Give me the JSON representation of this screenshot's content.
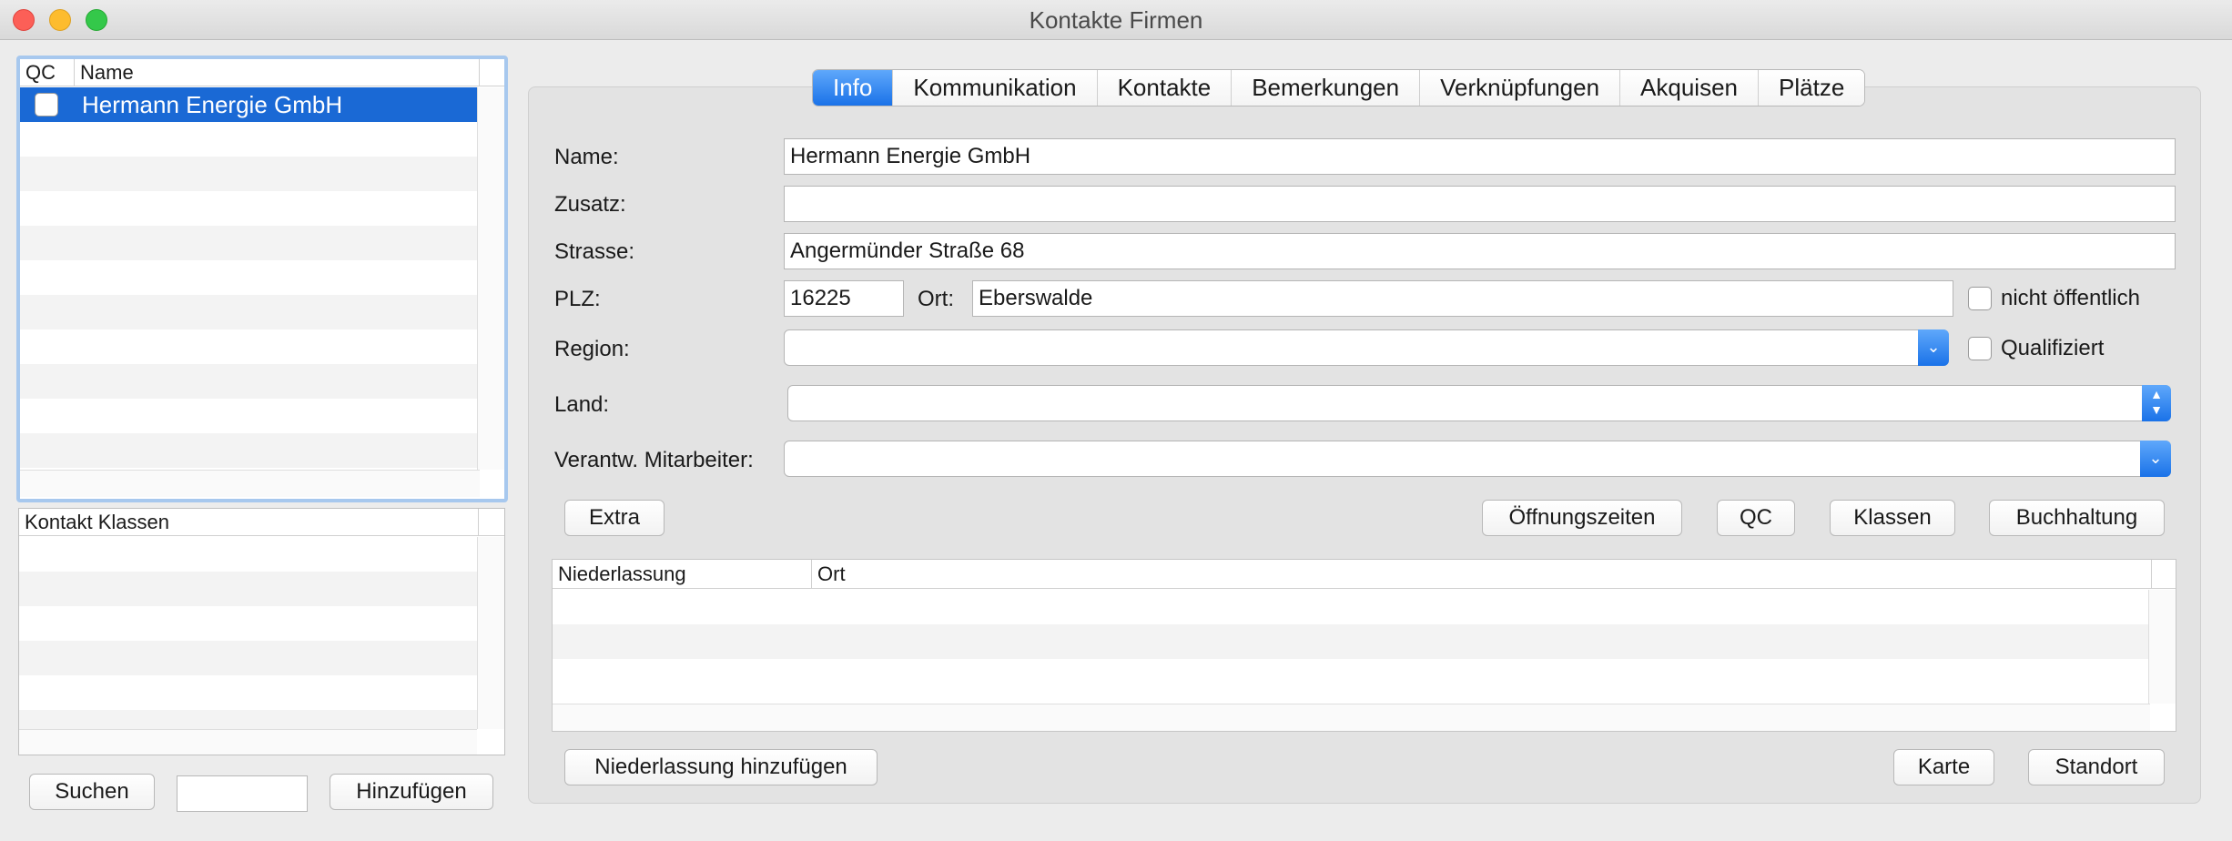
{
  "window": {
    "title": "Kontakte Firmen"
  },
  "company_list": {
    "columns": [
      "QC",
      "Name"
    ],
    "selected_row": {
      "qc_checked": false,
      "name": "Hermann Energie GmbH"
    }
  },
  "classes_list": {
    "column": "Kontakt Klassen"
  },
  "left_buttons": {
    "search": "Suchen",
    "add": "Hinzufügen",
    "search_value": ""
  },
  "tabs": [
    "Info",
    "Kommunikation",
    "Kontakte",
    "Bemerkungen",
    "Verknüpfungen",
    "Akquisen",
    "Plätze"
  ],
  "active_tab": "Info",
  "form": {
    "name_label": "Name:",
    "name_value": "Hermann Energie GmbH",
    "zusatz_label": "Zusatz:",
    "zusatz_value": "",
    "strasse_label": "Strasse:",
    "strasse_value": "Angermünder Straße 68",
    "plz_label": "PLZ:",
    "plz_value": "16225",
    "ort_label": "Ort:",
    "ort_value": "Eberswalde",
    "nicht_oeffentlich_label": "nicht öffentlich",
    "region_label": "Region:",
    "region_value": "",
    "qualifiziert_label": "Qualifiziert",
    "land_label": "Land:",
    "land_value": "",
    "mitarbeiter_label": "Verantw. Mitarbeiter:",
    "mitarbeiter_value": ""
  },
  "action_buttons": {
    "extra": "Extra",
    "oeffnungszeiten": "Öffnungszeiten",
    "qc": "QC",
    "klassen": "Klassen",
    "buchhaltung": "Buchhaltung"
  },
  "niederlassung_table": {
    "columns": [
      "Niederlassung",
      "Ort"
    ]
  },
  "bottom_buttons": {
    "add_branch": "Niederlassung hinzufügen",
    "map": "Karte",
    "location": "Standort"
  }
}
